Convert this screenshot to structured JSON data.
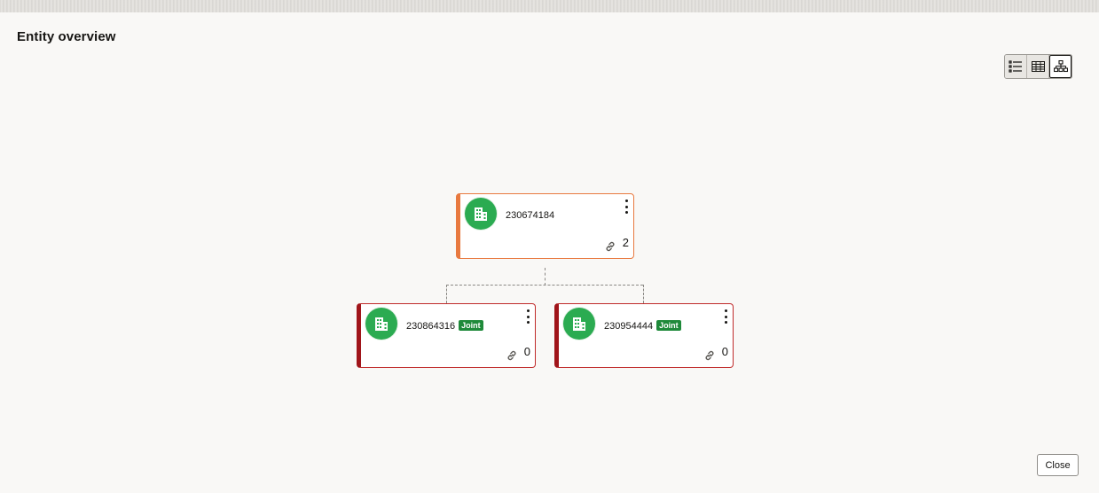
{
  "page": {
    "title": "Entity overview"
  },
  "view_toggle": {
    "options": [
      {
        "name": "list-view",
        "icon": "list-icon"
      },
      {
        "name": "table-view",
        "icon": "table-icon"
      },
      {
        "name": "hierarchy-view",
        "icon": "hierarchy-icon",
        "selected": true
      }
    ]
  },
  "tree": {
    "root": {
      "id": "230674184",
      "linked_count": "2"
    },
    "children": [
      {
        "id": "230864316",
        "badge": "Joint",
        "linked_count": "0"
      },
      {
        "id": "230954444",
        "badge": "Joint",
        "linked_count": "0"
      }
    ]
  },
  "colors": {
    "root_accent": "#e8793f",
    "child_accent": "#a0151a",
    "avatar": "#2bab51",
    "badge": "#1f8a3a"
  },
  "footer": {
    "close_label": "Close"
  }
}
